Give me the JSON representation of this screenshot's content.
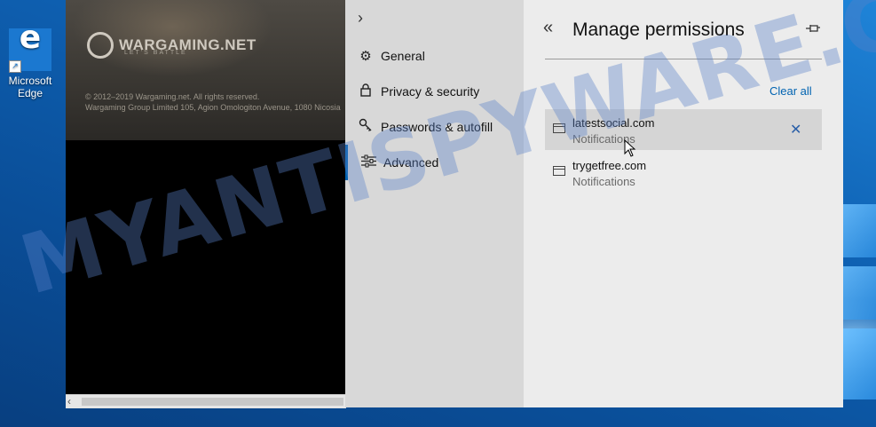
{
  "desktop": {
    "icon_label": "Microsoft Edge",
    "icon_label_line1": "Microsoft",
    "icon_label_line2": "Edge"
  },
  "webpage": {
    "brand": "WARGAMING.NET",
    "tagline": "LET'S BATTLE",
    "copyright": "© 2012–2019 Wargaming.net. All rights reserved.",
    "address": "Wargaming Group Limited 105, Agion Omologiton Avenue, 1080 Nicosia"
  },
  "settings_nav": {
    "items": [
      {
        "label": "General",
        "icon": "gear-icon"
      },
      {
        "label": "Privacy & security",
        "icon": "lock-icon"
      },
      {
        "label": "Passwords & autofill",
        "icon": "key-icon"
      },
      {
        "label": "Advanced",
        "icon": "sliders-icon",
        "active": true
      }
    ]
  },
  "permissions": {
    "title": "Manage permissions",
    "clear_all": "Clear all",
    "sites": [
      {
        "domain": "latestsocial.com",
        "permission": "Notifications"
      },
      {
        "domain": "trygetfree.com",
        "permission": "Notifications"
      }
    ]
  },
  "watermark": "MYANTISPYWARE.COM",
  "colors": {
    "accent": "#0063b1",
    "nav_bg": "#d8d8d8",
    "panel_bg": "#ececec",
    "hover_row": "#d5d5d5"
  }
}
